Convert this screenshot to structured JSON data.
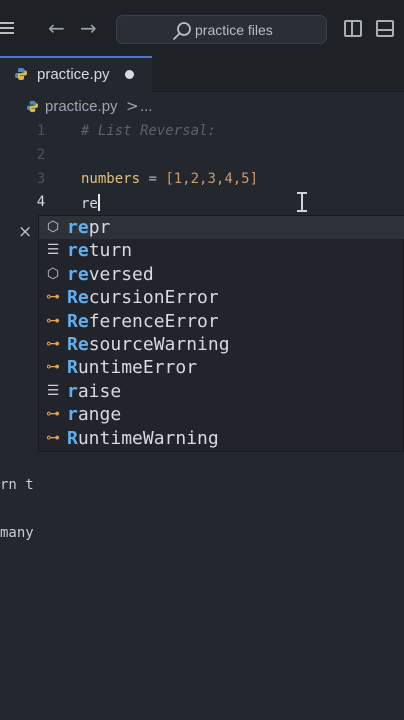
{
  "titlebar": {
    "search_placeholder": "practice files",
    "back_arrow": "←",
    "forward_arrow": "→",
    "icons": [
      "menu-icon",
      "search-icon",
      "toggle-sidebar-icon",
      "toggle-panel-icon"
    ]
  },
  "tab": {
    "label": "practice.py",
    "icon": "python-icon",
    "accent": "#4d78cc"
  },
  "breadcrumb": {
    "file": "practice.py",
    "separator": ">",
    "more": "..."
  },
  "editor": {
    "lines": [
      {
        "num": "1",
        "text": "# List Reversal:"
      },
      {
        "num": "2",
        "text": ""
      },
      {
        "num": "3",
        "var": "numbers",
        "op": " = ",
        "value": "[1,2,3,4,5]"
      },
      {
        "num": "4",
        "text": "re"
      }
    ]
  },
  "suggest": {
    "close": "×",
    "items": [
      {
        "match": "re",
        "rest": "pr",
        "kind": "method-icon",
        "glyph": "⬡"
      },
      {
        "match": "re",
        "rest": "turn",
        "kind": "keyword-icon",
        "glyph": "☰"
      },
      {
        "match": "re",
        "rest": "versed",
        "kind": "method-icon",
        "glyph": "⬡"
      },
      {
        "match": "Re",
        "rest": "cursionError",
        "kind": "class-icon",
        "glyph": "⊶"
      },
      {
        "match": "Re",
        "rest": "ferenceError",
        "kind": "class-icon",
        "glyph": "⊶"
      },
      {
        "match": "Re",
        "rest": "sourceWarning",
        "kind": "class-icon",
        "glyph": "⊶"
      },
      {
        "match": "R",
        "rest": "untimeError",
        "kind": "class-icon",
        "glyph": "⊶"
      },
      {
        "match": "r",
        "rest": "aise",
        "kind": "keyword-icon",
        "glyph": "☰"
      },
      {
        "match": "r",
        "rest": "ange",
        "kind": "class-icon",
        "glyph": "⊶"
      },
      {
        "match": "R",
        "rest": "untimeWarning",
        "kind": "class-icon",
        "glyph": "⊶"
      }
    ]
  },
  "peek": {
    "line1": "rn t",
    "line2": "many"
  },
  "colors": {
    "background": "#23272e",
    "comment": "#5c6370",
    "variable": "#e5c07b",
    "number": "#d19a66",
    "match_highlight": "#61afef"
  }
}
